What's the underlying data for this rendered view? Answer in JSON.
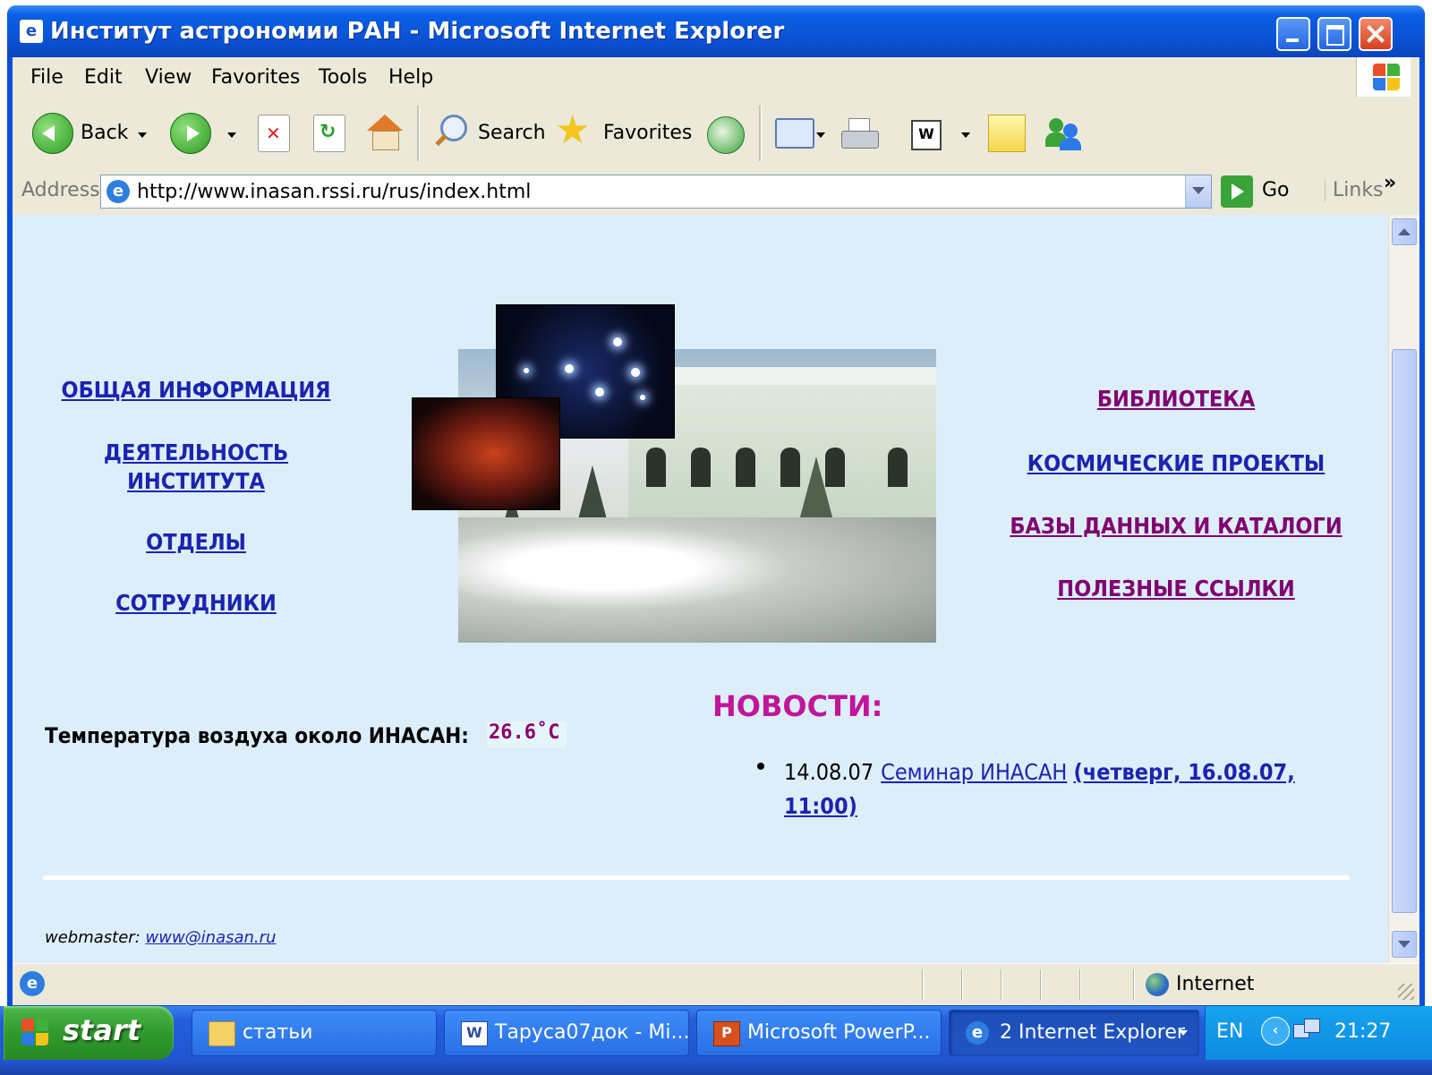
{
  "window": {
    "title": "Институт астрономии РАН - Microsoft Internet Explorer"
  },
  "menu": [
    "File",
    "Edit",
    "View",
    "Favorites",
    "Tools",
    "Help"
  ],
  "toolbar": {
    "back_label": "Back",
    "search_label": "Search",
    "favorites_label": "Favorites"
  },
  "address": {
    "label": "Address",
    "url": "http://www.inasan.rssi.ru/rus/index.html",
    "go_label": "Go",
    "links_label": "Links"
  },
  "page": {
    "left_nav": [
      "ОБЩАЯ ИНФОРМАЦИЯ",
      "ДЕЯТЕЛЬНОСТЬ ИНСТИТУТА",
      "ОТДЕЛЫ",
      "СОТРУДНИКИ"
    ],
    "right_nav": [
      "БИБЛИОТЕКА",
      "КОСМИЧЕСКИЕ ПРОЕКТЫ",
      "БАЗЫ ДАННЫХ И КАТАЛОГИ",
      "ПОЛЕЗНЫЕ ССЫЛКИ"
    ],
    "temperature_label": "Температура воздуха около ИНАСАН:",
    "temperature_value": "26.6˚C",
    "news_title": "НОВОСТИ:",
    "news": {
      "date": "14.08.07",
      "link_text": "Семинар ИНАСАН",
      "link_bold_1": "(четверг, 16.08.07,",
      "link_bold_2": "11:00)"
    },
    "webmaster_label": "webmaster:",
    "webmaster_email": "www@inasan.ru"
  },
  "status": {
    "zone": "Internet"
  },
  "taskbar": {
    "start_label": "start",
    "tasks": [
      "статьи",
      "Таруса07док - Mi...",
      "Microsoft PowerP...",
      "2 Internet Explorer"
    ],
    "lang": "EN",
    "clock": "21:27"
  },
  "colors": {
    "page_background": "#ddeefb",
    "link_blue": "#1b24b0",
    "link_visited_purple": "#800070",
    "news_title": "#c0169a",
    "titlebar_blue": "#0a5fe6",
    "start_green": "#2f9a2d"
  }
}
